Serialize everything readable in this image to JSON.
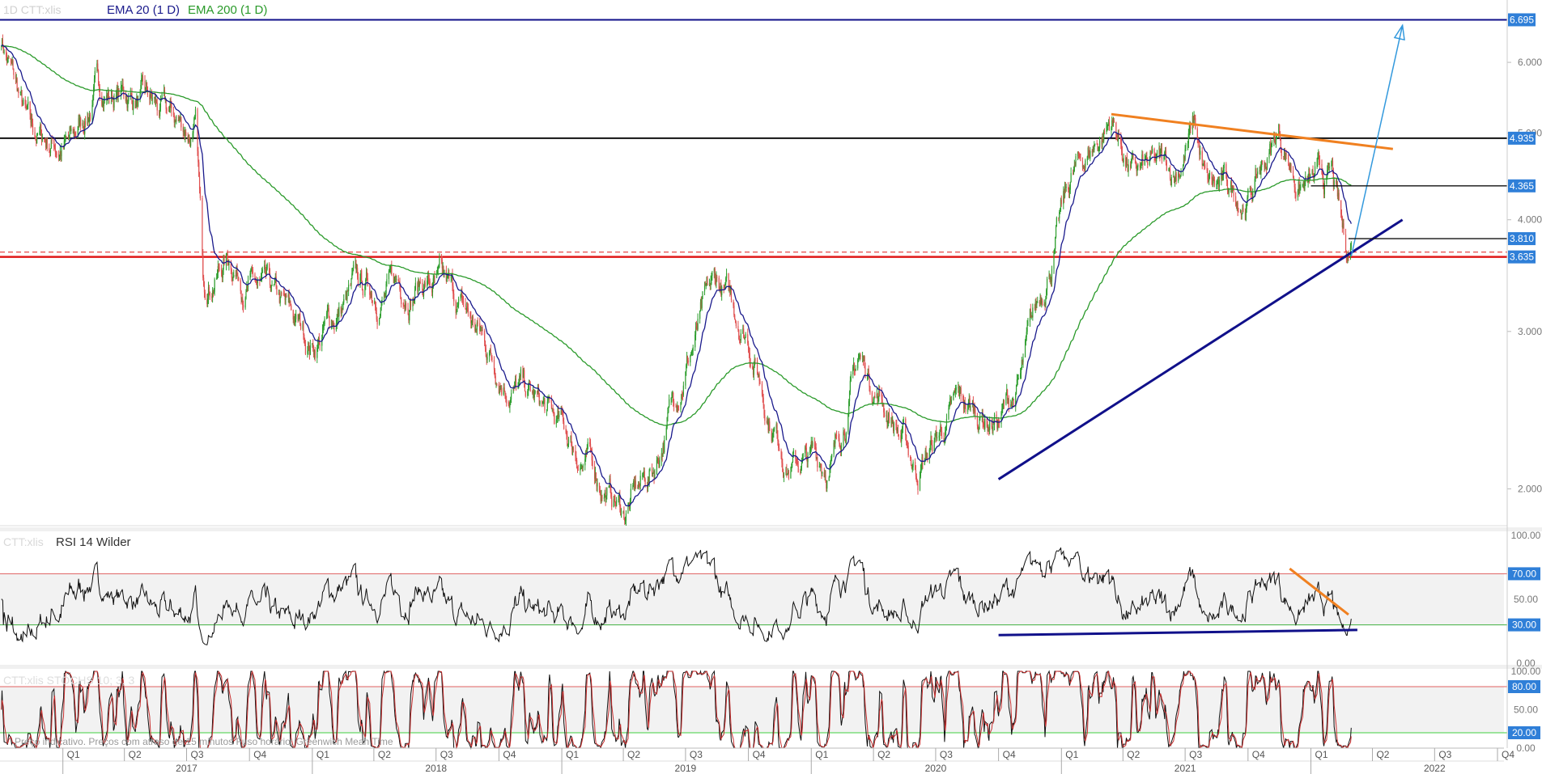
{
  "header": {
    "symbol_faded": "1D  CTT:xlis",
    "ema20_label": "EMA 20  (1 D)",
    "ema200_label": "EMA 200  (1 D)"
  },
  "rsi_panel": {
    "symbol_faded": "CTT:xlis",
    "label": "RSI 14 Wilder"
  },
  "stoch_panel": {
    "label_faded": "CTT:xlis  STOCHS 10; 3; 3"
  },
  "footer_note": "Preço indicativo. Preços com atraso de 15 minutos   Fuso horário: Greenwich Mean Time",
  "colors": {
    "up": "#2e9e2e",
    "down": "#e05050",
    "ema20": "#1a1a8c",
    "ema200": "#2a9a2a",
    "support": "#e01818",
    "trend_blue": "#10108a",
    "trend_orange": "#f08020",
    "arrow": "#3399dd",
    "tag_bg": "#2f7fd8"
  },
  "chart_data": [
    {
      "type": "candlestick",
      "title": "CTT:xlis",
      "ylim": [
        1.8,
        6.9
      ],
      "log_scale": true,
      "y_ticks": [
        "2.000",
        "3.000",
        "4.000",
        "5.000",
        "6.000"
      ],
      "price_tags": [
        "6.695",
        "4.935",
        "4.365",
        "3.810",
        "3.635"
      ],
      "horizontal_lines": [
        6.695,
        4.935,
        4.365,
        3.81,
        3.635,
        3.68
      ],
      "anchor_closes": [
        {
          "date": "2016-10-01",
          "close": 6.5
        },
        {
          "date": "2016-11-15",
          "close": 4.9
        },
        {
          "date": "2017-01-15",
          "close": 4.85
        },
        {
          "date": "2017-02-20",
          "close": 5.6
        },
        {
          "date": "2017-04-15",
          "close": 5.5
        },
        {
          "date": "2017-06-01",
          "close": 5.15
        },
        {
          "date": "2017-07-15",
          "close": 5.0
        },
        {
          "date": "2017-07-25",
          "close": 3.4
        },
        {
          "date": "2017-09-01",
          "close": 3.65
        },
        {
          "date": "2017-11-01",
          "close": 3.2
        },
        {
          "date": "2018-01-01",
          "close": 2.9
        },
        {
          "date": "2018-03-01",
          "close": 3.3
        },
        {
          "date": "2018-05-01",
          "close": 3.35
        },
        {
          "date": "2018-06-15",
          "close": 3.45
        },
        {
          "date": "2018-08-15",
          "close": 3.1
        },
        {
          "date": "2018-10-01",
          "close": 2.75
        },
        {
          "date": "2018-12-01",
          "close": 2.45
        },
        {
          "date": "2019-02-15",
          "close": 2.1
        },
        {
          "date": "2019-04-01",
          "close": 1.88
        },
        {
          "date": "2019-05-15",
          "close": 2.1
        },
        {
          "date": "2019-07-01",
          "close": 2.8
        },
        {
          "date": "2019-08-15",
          "close": 3.35
        },
        {
          "date": "2019-10-01",
          "close": 3.0
        },
        {
          "date": "2019-11-01",
          "close": 2.45
        },
        {
          "date": "2019-12-01",
          "close": 2.15
        },
        {
          "date": "2020-02-01",
          "close": 2.15
        },
        {
          "date": "2020-03-10",
          "close": 2.8
        },
        {
          "date": "2020-05-01",
          "close": 2.4
        },
        {
          "date": "2020-06-01",
          "close": 2.1
        },
        {
          "date": "2020-08-01",
          "close": 2.45
        },
        {
          "date": "2020-10-01",
          "close": 2.4
        },
        {
          "date": "2020-11-01",
          "close": 2.6
        },
        {
          "date": "2020-12-15",
          "close": 3.6
        },
        {
          "date": "2021-01-15",
          "close": 4.4
        },
        {
          "date": "2021-03-15",
          "close": 5.2
        },
        {
          "date": "2021-04-15",
          "close": 4.5
        },
        {
          "date": "2021-06-15",
          "close": 4.5
        },
        {
          "date": "2021-07-15",
          "close": 5.1
        },
        {
          "date": "2021-08-01",
          "close": 4.3
        },
        {
          "date": "2021-10-01",
          "close": 4.25
        },
        {
          "date": "2021-11-15",
          "close": 5.0
        },
        {
          "date": "2021-12-15",
          "close": 4.4
        },
        {
          "date": "2022-01-15",
          "close": 4.35
        },
        {
          "date": "2022-02-01",
          "close": 4.4
        },
        {
          "date": "2022-02-20",
          "close": 3.65
        },
        {
          "date": "2022-03-01",
          "close": 3.75
        }
      ],
      "ema_periods": [
        20,
        200
      ],
      "drawings": [
        {
          "type": "trendline",
          "color": "trend_orange",
          "from": [
            "2021-03-15",
            5.25
          ],
          "to": [
            "2022-05-01",
            4.8
          ]
        },
        {
          "type": "trendline",
          "color": "trend_blue",
          "from": [
            "2020-10-01",
            2.05
          ],
          "to": [
            "2022-05-15",
            4.0
          ]
        },
        {
          "type": "arrow",
          "color": "arrow",
          "from": [
            "2022-03-01",
            3.64
          ],
          "to": [
            "2022-05-15",
            6.6
          ]
        },
        {
          "type": "segment",
          "from": [
            "2022-01-01",
            4.365
          ],
          "to": [
            "2022-06-01",
            4.365
          ]
        },
        {
          "type": "segment",
          "from": [
            "2022-02-25",
            3.81
          ],
          "to": [
            "2022-06-01",
            3.81
          ]
        }
      ]
    },
    {
      "type": "line",
      "title": "RSI 14 Wilder",
      "ylim": [
        0,
        100
      ],
      "y_ticks": [
        "100.00",
        "70.00",
        "50.00",
        "30.00",
        "0.00"
      ],
      "tagged_ticks": [
        "70.00",
        "30.00"
      ],
      "levels": [
        70,
        30
      ],
      "band": [
        30,
        70
      ],
      "drawings": [
        {
          "type": "trendline",
          "color": "trend_orange",
          "from": [
            "2021-12-01",
            74
          ],
          "to": [
            "2022-02-25",
            38
          ]
        },
        {
          "type": "trendline",
          "color": "trend_blue",
          "from": [
            "2020-10-01",
            22
          ],
          "to": [
            "2022-03-10",
            26
          ]
        }
      ]
    },
    {
      "type": "line",
      "title": "STOCHS 10; 3; 3",
      "ylim": [
        0,
        100
      ],
      "y_ticks": [
        "100.00",
        "80.00",
        "50.00",
        "20.00",
        "0.00"
      ],
      "tagged_ticks": [
        "80.00",
        "20.00"
      ],
      "levels": [
        80,
        20
      ],
      "band": [
        20,
        80
      ]
    }
  ],
  "x_axis": {
    "quarters": [
      "Q1",
      "Q2",
      "Q3",
      "Q4",
      "Q1",
      "Q2",
      "Q3",
      "Q4",
      "Q1",
      "Q2",
      "Q3",
      "Q4",
      "Q1",
      "Q2",
      "Q3",
      "Q4",
      "Q1",
      "Q2",
      "Q3",
      "Q4",
      "Q1",
      "Q2",
      "Q3",
      "Q4",
      "Q1",
      "Q2",
      "Q3",
      "Q4"
    ],
    "years": [
      "2017",
      "2018",
      "2019",
      "2020",
      "2021",
      "2022"
    ]
  }
}
